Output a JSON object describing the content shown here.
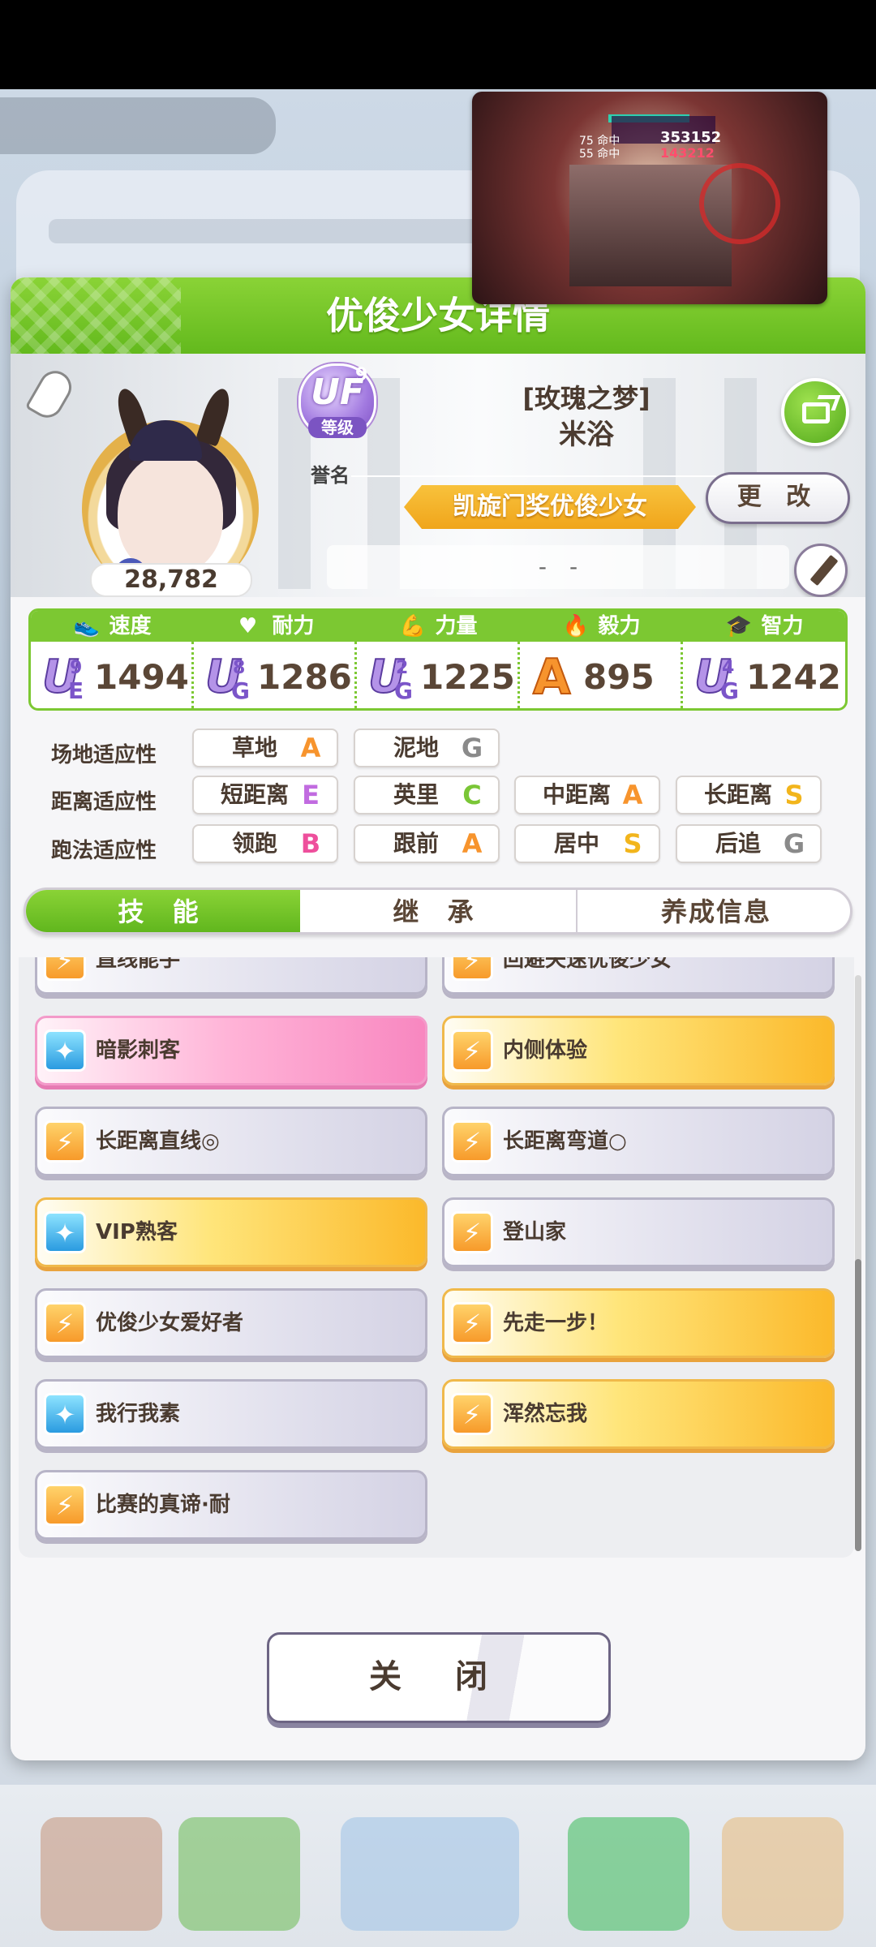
{
  "modal": {
    "title": "优俊少女详情"
  },
  "profile": {
    "fans": "28,782",
    "rank_badge": "UF",
    "rank_sub": "9",
    "rank_level": "等级",
    "rank_label": "誉名",
    "char_title": "[玫瑰之梦]",
    "char_name": "米浴",
    "title_ribbon": "凯旋门奖优俊少女",
    "change_label": "更 改",
    "comment": "-　-"
  },
  "stats": [
    {
      "name": "速度",
      "icon": "shoe-icon",
      "grade": "U",
      "grade_sup": "9",
      "grade_sub": "E",
      "value": "1494"
    },
    {
      "name": "耐力",
      "icon": "heart-icon",
      "grade": "U",
      "grade_sup": "8",
      "grade_sub": "G",
      "value": "1286"
    },
    {
      "name": "力量",
      "icon": "muscle-icon",
      "grade": "U",
      "grade_sup": "2",
      "grade_sub": "G",
      "value": "1225"
    },
    {
      "name": "毅力",
      "icon": "flame-icon",
      "grade": "A",
      "grade_sup": "",
      "grade_sub": "",
      "value": "895"
    },
    {
      "name": "智力",
      "icon": "graduation-cap-icon",
      "grade": "U",
      "grade_sup": "4",
      "grade_sub": "G",
      "value": "1242"
    }
  ],
  "aptitude": {
    "track_label": "场地适应性",
    "track": [
      {
        "name": "草地",
        "grade": "A"
      },
      {
        "name": "泥地",
        "grade": "G"
      }
    ],
    "distance_label": "距离适应性",
    "distance": [
      {
        "name": "短距离",
        "grade": "E"
      },
      {
        "name": "英里",
        "grade": "C"
      },
      {
        "name": "中距离",
        "grade": "A"
      },
      {
        "name": "长距离",
        "grade": "S"
      }
    ],
    "style_label": "跑法适应性",
    "style": [
      {
        "name": "领跑",
        "grade": "B"
      },
      {
        "name": "跟前",
        "grade": "A"
      },
      {
        "name": "居中",
        "grade": "S"
      },
      {
        "name": "后追",
        "grade": "G"
      }
    ]
  },
  "tabs": [
    "技 能",
    "继 承",
    "养成信息"
  ],
  "skills": [
    {
      "name": "直线能手",
      "style": "normal",
      "icon": "orange"
    },
    {
      "name": "回避失速优俊少女",
      "style": "normal",
      "icon": "orange"
    },
    {
      "name": "暗影刺客",
      "style": "pink",
      "icon": "blue"
    },
    {
      "name": "内侧体验",
      "style": "gold",
      "icon": "orange"
    },
    {
      "name": "长距离直线◎",
      "style": "normal",
      "icon": "orange"
    },
    {
      "name": "长距离弯道○",
      "style": "normal",
      "icon": "orange"
    },
    {
      "name": "VIP熟客",
      "style": "gold",
      "icon": "blue"
    },
    {
      "name": "登山家",
      "style": "normal",
      "icon": "orange"
    },
    {
      "name": "优俊少女爱好者",
      "style": "normal",
      "icon": "orange"
    },
    {
      "name": "先走一步！",
      "style": "gold",
      "icon": "orange"
    },
    {
      "name": "我行我素",
      "style": "normal",
      "icon": "blue"
    },
    {
      "name": "浑然忘我",
      "style": "gold",
      "icon": "orange"
    },
    {
      "name": "比赛的真谛·耐",
      "style": "normal",
      "icon": "orange"
    }
  ],
  "close_label": "关 闭",
  "pip": {
    "n1": "353152",
    "n2": "143212",
    "n3": "75 命中",
    "n4": "55 命中"
  }
}
